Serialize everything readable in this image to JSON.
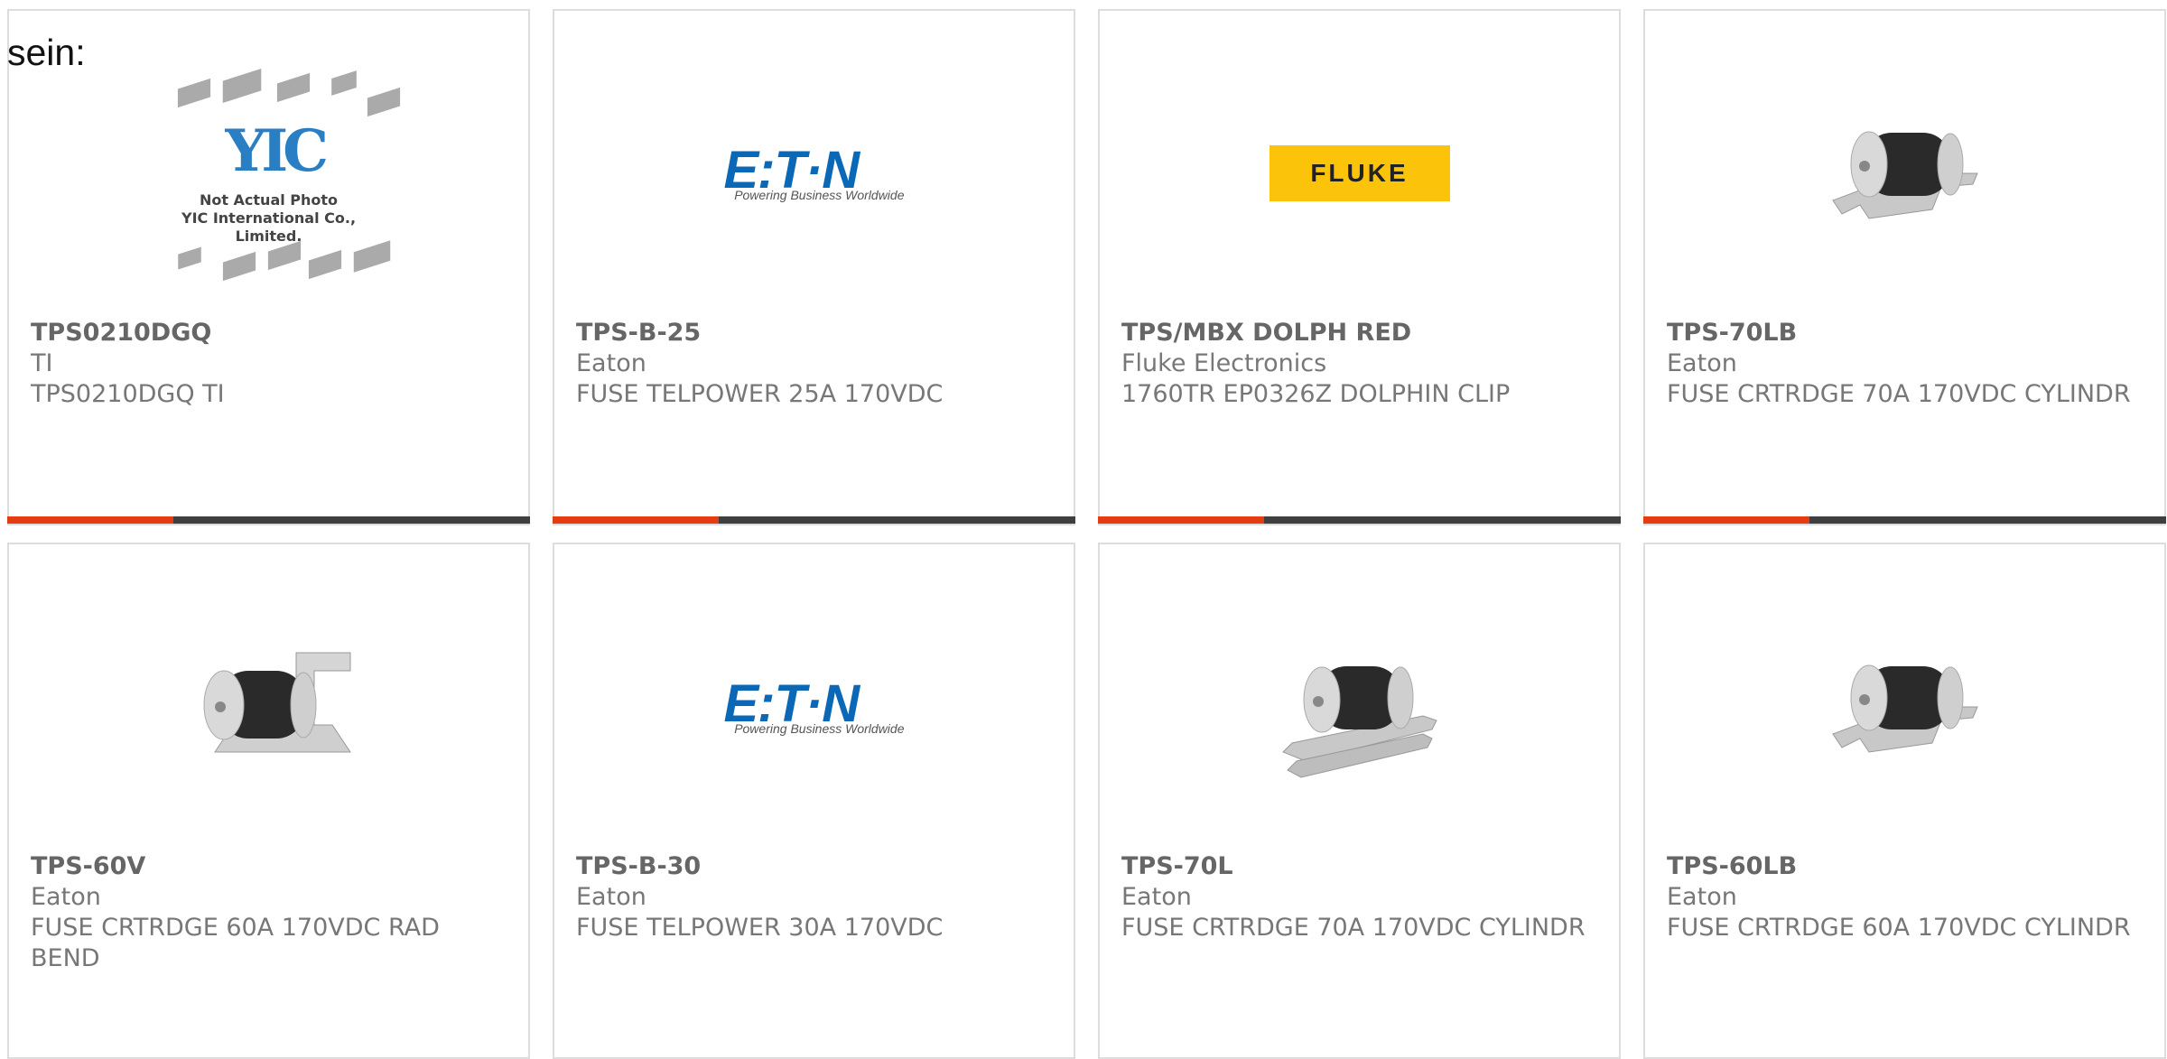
{
  "heading": "sein:",
  "products": [
    {
      "part": "TPS0210DGQ",
      "manufacturer": "TI",
      "description": "TPS0210DGQ TI",
      "image": "not-actual-photo-icon",
      "image_text": [
        "Not Actual Photo",
        "YIC International Co., Limited."
      ]
    },
    {
      "part": "TPS-B-25",
      "manufacturer": "Eaton",
      "description": "FUSE TELPOWER 25A 170VDC",
      "image": "eaton-logo-icon",
      "logo_text": "E:T·N",
      "logo_tagline": "Powering Business Worldwide"
    },
    {
      "part": "TPS/MBX DOLPH RED",
      "manufacturer": "Fluke Electronics",
      "description": "1760TR EP0326Z DOLPHIN CLIP",
      "image": "fluke-logo-icon",
      "logo_text": "FLUKE"
    },
    {
      "part": "TPS-70LB",
      "manufacturer": "Eaton",
      "description": "FUSE CRTRDGE 70A 170VDC CYLINDR",
      "image": "fuse-cartridge-icon"
    },
    {
      "part": "TPS-60V",
      "manufacturer": "Eaton",
      "description": "FUSE CRTRDGE 60A 170VDC RAD BEND",
      "image": "fuse-cartridge-icon"
    },
    {
      "part": "TPS-B-30",
      "manufacturer": "Eaton",
      "description": "FUSE TELPOWER 30A 170VDC",
      "image": "eaton-logo-icon",
      "logo_text": "E:T·N",
      "logo_tagline": "Powering Business Worldwide"
    },
    {
      "part": "TPS-70L",
      "manufacturer": "Eaton",
      "description": "FUSE CRTRDGE 70A 170VDC CYLINDR",
      "image": "fuse-cartridge-icon"
    },
    {
      "part": "TPS-60LB",
      "manufacturer": "Eaton",
      "description": "FUSE CRTRDGE 60A 170VDC CYLINDR",
      "image": "fuse-cartridge-icon"
    }
  ],
  "colors": {
    "accent": "#e63c12",
    "bar": "#3f3f3f",
    "border": "#dddddd",
    "eaton_blue": "#0a68b6",
    "fluke_yellow": "#fcc30b"
  }
}
